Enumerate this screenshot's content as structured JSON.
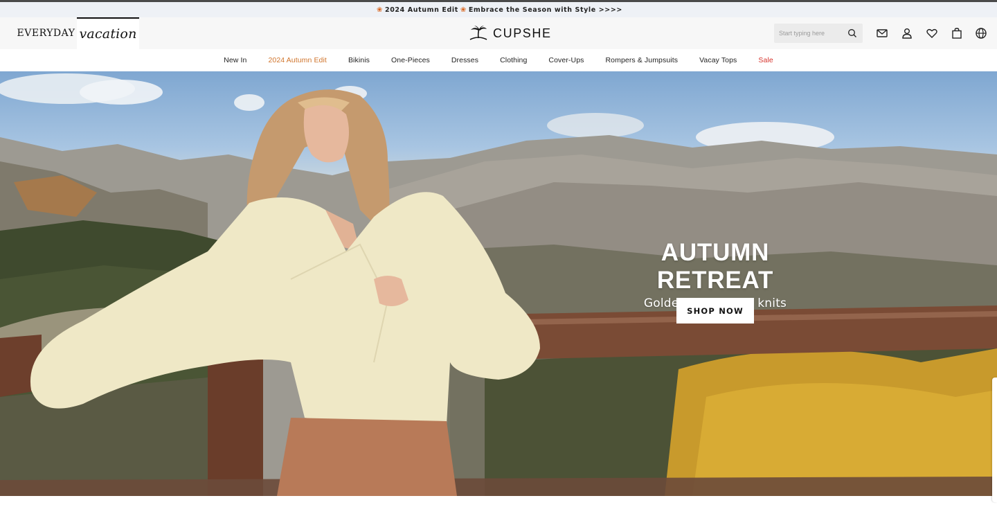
{
  "announcement": {
    "year_text": "2024 Autumn Edit",
    "message": "Embrace the Season with Style >>>>",
    "leaf_icon": "maple-leaf-icon"
  },
  "header": {
    "brand_everyday": "EVERYDAY",
    "brand_vacation": "vacation",
    "logo_text": "CUPSHE",
    "search_placeholder": "Start typing here",
    "icons": [
      "search-icon",
      "mail-icon",
      "user-icon",
      "heart-icon",
      "bag-icon",
      "globe-icon"
    ]
  },
  "nav": {
    "items": [
      {
        "label": "New In"
      },
      {
        "label": "2024 Autumn Edit"
      },
      {
        "label": "Bikinis"
      },
      {
        "label": "One-Pieces"
      },
      {
        "label": "Dresses"
      },
      {
        "label": "Clothing"
      },
      {
        "label": "Cover-Ups"
      },
      {
        "label": "Rompers & Jumpsuits"
      },
      {
        "label": "Vacay Tops"
      },
      {
        "label": "Sale"
      }
    ]
  },
  "hero": {
    "title": "AUTUMN RETREAT",
    "subtitle": "Golden days, cozy knits",
    "cta": "SHOP NOW"
  },
  "colors": {
    "autumn_accent": "#d0742b",
    "sale_accent": "#d6332c",
    "announcement_bg": "#eef1f6",
    "header_bg": "#f7f7f7"
  }
}
